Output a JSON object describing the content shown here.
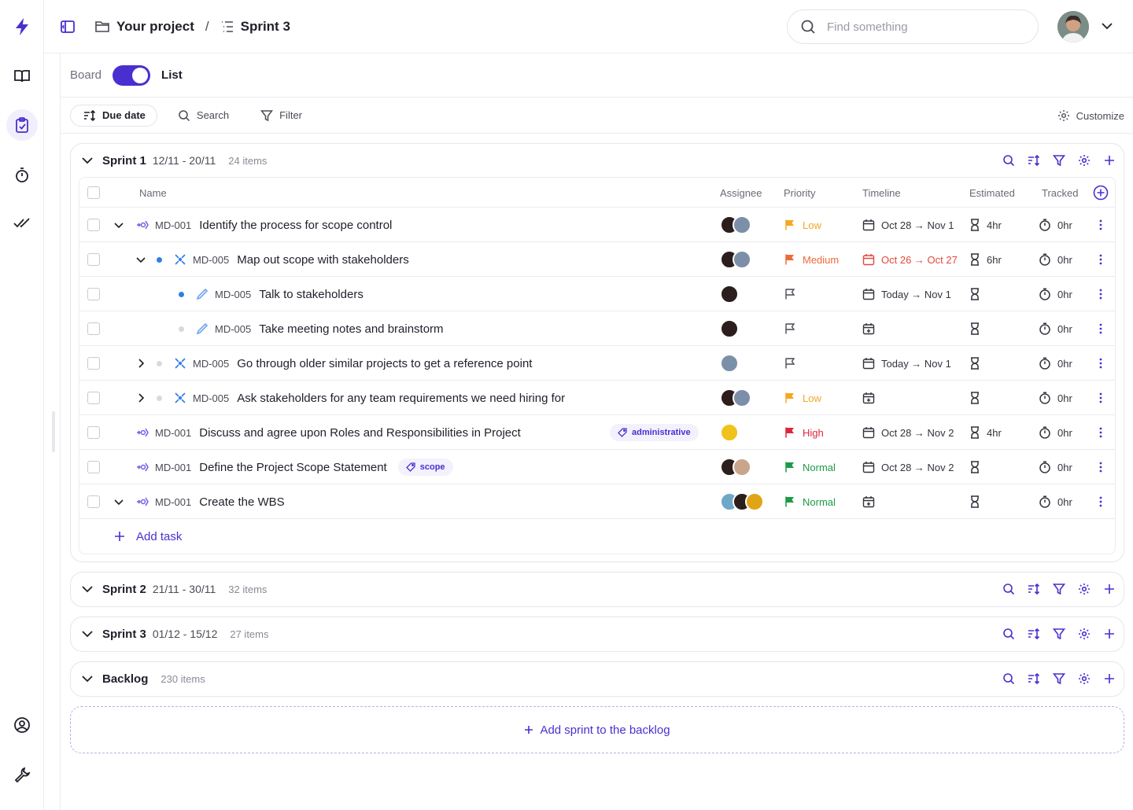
{
  "breadcrumb": {
    "project": "Your project",
    "separator": "/",
    "sprint": "Sprint 3"
  },
  "search": {
    "placeholder": "Find something"
  },
  "view": {
    "board_label": "Board",
    "list_label": "List",
    "list_active": true
  },
  "toolbar": {
    "sort_label": "Due date",
    "search_label": "Search",
    "filter_label": "Filter",
    "customize_label": "Customize"
  },
  "columns": {
    "name": "Name",
    "assignee": "Assignee",
    "priority": "Priority",
    "timeline": "Timeline",
    "estimated": "Estimated",
    "tracked": "Tracked"
  },
  "colors": {
    "accent": "#4a2fd0",
    "low": "#f5a623",
    "medium": "#ee6a3a",
    "high": "#e0243a",
    "normal": "#1c9a45",
    "blue_dot": "#2f7ee6"
  },
  "sprint1": {
    "name": "Sprint 1",
    "dates": "12/11 - 20/11",
    "count": "24 items",
    "rows": [
      {
        "code": "MD-001",
        "name": "Identify the process for scope control",
        "priority": "Low",
        "timeline": "Oct 28 → Nov 1",
        "estimated": "4hr",
        "tracked": "0hr"
      },
      {
        "code": "MD-005",
        "name": "Map out scope with stakeholders",
        "priority": "Medium",
        "timeline": "Oct 26 → Oct 27",
        "estimated": "6hr",
        "tracked": "0hr"
      },
      {
        "code": "MD-005",
        "name": "Talk to stakeholders",
        "priority": "",
        "timeline": "Today → Nov 1",
        "estimated": "",
        "tracked": "0hr"
      },
      {
        "code": "MD-005",
        "name": "Take meeting notes and brainstorm",
        "priority": "",
        "timeline": "",
        "estimated": "",
        "tracked": "0hr"
      },
      {
        "code": "MD-005",
        "name": "Go through older similar projects to get a reference point",
        "priority": "",
        "timeline": "Today → Nov 1",
        "estimated": "",
        "tracked": "0hr"
      },
      {
        "code": "MD-005",
        "name": "Ask stakeholders for any team requirements we need hiring for",
        "priority": "Low",
        "timeline": "",
        "estimated": "",
        "tracked": "0hr"
      },
      {
        "code": "MD-001",
        "name": "Discuss and agree upon Roles and Responsibilities in Project",
        "tag": "administrative",
        "priority": "High",
        "timeline": "Oct 28 → Nov 2",
        "estimated": "4hr",
        "tracked": "0hr"
      },
      {
        "code": "MD-001",
        "name": "Define the Project Scope Statement",
        "tag": "scope",
        "priority": "Normal",
        "timeline": "Oct 28 → Nov 2",
        "estimated": "",
        "tracked": "0hr"
      },
      {
        "code": "MD-001",
        "name": "Create the WBS",
        "priority": "Normal",
        "timeline": "",
        "estimated": "",
        "tracked": "0hr"
      }
    ],
    "add_task": "Add task"
  },
  "sprint2": {
    "name": "Sprint 2",
    "dates": "21/11 - 30/11",
    "count": "32 items"
  },
  "sprint3": {
    "name": "Sprint 3",
    "dates": "01/12 - 15/12",
    "count": "27 items"
  },
  "backlog": {
    "name": "Backlog",
    "count": "230 items"
  },
  "add_sprint": "Add sprint to the backlog",
  "icons": [
    "bolt-icon",
    "book-icon",
    "clipboard-check-icon",
    "stopwatch-icon",
    "double-check-icon",
    "user-circle-icon",
    "wrench-icon",
    "sidebar-toggle-icon",
    "folder-icon",
    "list-icon",
    "search-icon",
    "chevron-down-icon",
    "sort-icon",
    "filter-icon",
    "gear-icon",
    "plus-icon",
    "flag-icon",
    "calendar-icon",
    "hourglass-icon",
    "timer-icon",
    "more-vertical-icon",
    "tag-icon"
  ]
}
